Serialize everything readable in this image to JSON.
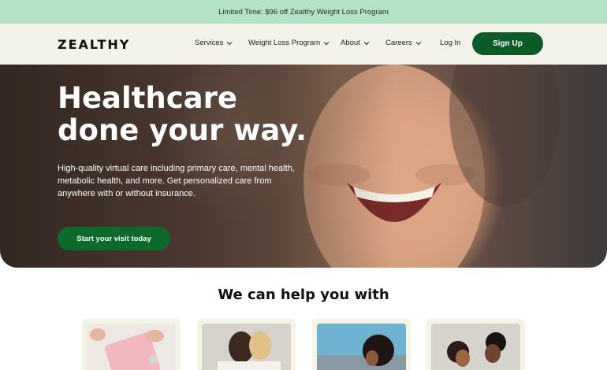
{
  "promo": {
    "text": "Limited Time: $96 off Zealthy Weight Loss Program"
  },
  "nav": {
    "logo": "ZEALTHY",
    "items": [
      {
        "label": "Services",
        "icon": "chevron-down-icon"
      },
      {
        "label": "Weight Loss Program",
        "icon": "chevron-down-icon"
      },
      {
        "label": "About",
        "icon": "chevron-down-icon"
      },
      {
        "label": "Careers",
        "icon": "chevron-down-icon"
      }
    ],
    "login": "Log In",
    "signup": "Sign Up"
  },
  "hero": {
    "title": "Healthcare done your way.",
    "subtitle": "High-quality virtual care including primary care, mental health, metabolic health, and more. Get personalized care from anywhere with or without insurance.",
    "cta": "Start your visit today"
  },
  "help": {
    "title": "We can help you with",
    "cards": [
      {
        "image": "bathroom-scale-photo"
      },
      {
        "image": "couple-embracing-photo"
      },
      {
        "image": "woman-curly-hair-photo"
      },
      {
        "image": "couple-smiling-photo"
      }
    ]
  },
  "colors": {
    "brand_green": "#0c5a28",
    "promo_bg": "#b3e3c4",
    "nav_bg": "#f3f3ec"
  }
}
